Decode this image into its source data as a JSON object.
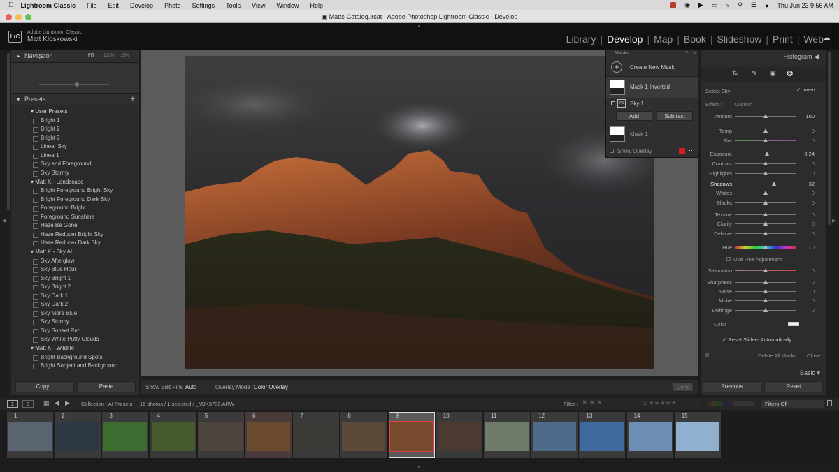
{
  "menubar": {
    "apple": "",
    "app": "Lightroom Classic",
    "items": [
      "File",
      "Edit",
      "Develop",
      "Photo",
      "Settings",
      "Tools",
      "View",
      "Window",
      "Help"
    ],
    "datetime": "Thu Jun 23  9:56 AM"
  },
  "window": {
    "title": "Matts-Catalog.lrcat - Adobe Photoshop Lightroom Classic - Develop"
  },
  "identity": {
    "logo": "LrC",
    "product": "Adobe Lightroom Classic",
    "user": "Matt Kloskowski"
  },
  "modules": [
    "Library",
    "Develop",
    "Map",
    "Book",
    "Slideshow",
    "Print",
    "Web"
  ],
  "navigator": {
    "title": "Navigator",
    "zoom": [
      "FIT",
      "100%",
      "25%"
    ]
  },
  "presets": {
    "title": "Presets",
    "groups": [
      {
        "name": "User Presets",
        "items": [
          "Bright 1",
          "Bright 2",
          "Bright 3",
          "Linear Sky",
          "Linear1",
          "Sky and Foreground",
          "Sky Stormy"
        ]
      },
      {
        "name": "Matt K - Landscape",
        "items": [
          "Bright Foreground Bright Sky",
          "Bright Foreground Dark Sky",
          "Foreground Bright",
          "Foreground Sunshine",
          "Haze Be Gone",
          "Haze Reducer Bright Sky",
          "Haze Reducer Dark Sky"
        ]
      },
      {
        "name": "Matt K - Sky AI",
        "items": [
          "Sky Afterglow",
          "Sky Blue Hour",
          "Sky Bright 1",
          "Sky Bright 2",
          "Sky Dark 1",
          "Sky Dark 2",
          "Sky More Blue",
          "Sky Stormy",
          "Sky Sunset Red",
          "Sky White Puffy Clouds"
        ]
      },
      {
        "name": "Matt K - Wildlife",
        "items": [
          "Bright Background Spots",
          "Bright Subject and Background"
        ]
      }
    ]
  },
  "left_buttons": {
    "copy": "Copy...",
    "paste": "Paste"
  },
  "toolbar": {
    "show_edit_pins_label": "Show Edit Pins :",
    "show_edit_pins_value": "Auto",
    "overlay_mode_label": "Overlay Mode :",
    "overlay_mode_value": "Color Overlay",
    "done": "Done"
  },
  "masks": {
    "title": "Masks",
    "create": "Create New Mask",
    "mask1_inverted": "Mask 1 Inverted",
    "sky1": "Sky 1",
    "add": "Add",
    "subtract": "Subtract",
    "mask1": "Mask 1",
    "show_overlay": "Show Overlay",
    "overlay_color": "#d22020"
  },
  "right": {
    "histogram": "Histogram",
    "select": "Select Sky",
    "invert": "Invert",
    "effect": "Effect :",
    "effect_value": "Custom",
    "sliders": [
      {
        "name": "Amount",
        "value": "100",
        "pos": 0.5
      },
      {
        "name": "Temp",
        "value": "0",
        "pos": 0.5
      },
      {
        "name": "Tint",
        "value": "0",
        "pos": 0.5
      },
      {
        "name": "Exposure",
        "value": "0.24",
        "pos": 0.53
      },
      {
        "name": "Contrast",
        "value": "0",
        "pos": 0.5
      },
      {
        "name": "Highlights",
        "value": "0",
        "pos": 0.5
      },
      {
        "name": "Shadows",
        "value": "32",
        "pos": 0.64
      },
      {
        "name": "Whites",
        "value": "0",
        "pos": 0.5
      },
      {
        "name": "Blacks",
        "value": "0",
        "pos": 0.5
      },
      {
        "name": "Texture",
        "value": "0",
        "pos": 0.5
      },
      {
        "name": "Clarity",
        "value": "0",
        "pos": 0.5
      },
      {
        "name": "Dehaze",
        "value": "0",
        "pos": 0.5
      },
      {
        "name": "Hue",
        "value": "0.0",
        "pos": 0.5
      },
      {
        "name": "Saturation",
        "value": "0",
        "pos": 0.5
      },
      {
        "name": "Sharpness",
        "value": "0",
        "pos": 0.5
      },
      {
        "name": "Noise",
        "value": "0",
        "pos": 0.5
      },
      {
        "name": "Moiré",
        "value": "0",
        "pos": 0.5
      },
      {
        "name": "Defringe",
        "value": "0",
        "pos": 0.5
      }
    ],
    "fine_adjust": "Use Fine Adjustment",
    "color": "Color",
    "reset_auto": "Reset Sliders Automatically",
    "delete_all": "Delete All Masks",
    "close": "Close",
    "basic": "Basic",
    "previous": "Previous",
    "reset": "Reset"
  },
  "filmbar": {
    "pages": [
      "1",
      "2"
    ],
    "collection": "Collection : AI Presets",
    "info": "15 photos / 1 selected / _MJK3700.ARW",
    "filter": "Filter :",
    "filters_off": "Filters Off"
  },
  "filmstrip": [
    "1",
    "2",
    "3",
    "4",
    "5",
    "6",
    "7",
    "8",
    "9",
    "10",
    "11",
    "12",
    "13",
    "14",
    "15"
  ],
  "thumb_colors": [
    "#5a6470",
    "#2e3844",
    "#3d6b30",
    "#465a2c",
    "#4d4440",
    "#6a4a30",
    "#3d3b38",
    "#5b4a3a",
    "#7a4a30",
    "#4a3a30",
    "#6e7a6a",
    "#4f6a8a",
    "#3f6aa0",
    "#6d8fb4",
    "#8fb0cf"
  ]
}
